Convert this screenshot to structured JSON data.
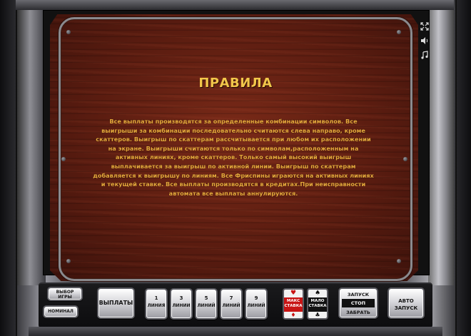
{
  "rules": {
    "title": "ПРАВИЛА",
    "text": "Все выплаты производятся за определенные комбинации символов. Все выигрыши за комбинации последовательно считаются слева направо, кроме скаттеров. Выигрыш по скаттерам рассчитывается при любом их расположении на экране. Выигрыши считаются только по символам,расположенным на активных линиях, кроме скаттеров. Только самый высокий выигрыш выплачивается за выигрыш по активной линии. Выигрыш по скаттерам добавляется к выигрышу по линиям. Все Фриспины играются на активных линиях и текущей ставке. Все выплаты производятся в кредитах.При неисправности автомата все выплаты аннулируются."
  },
  "top_icons": [
    "fullscreen-icon",
    "sound-icon",
    "music-icon"
  ],
  "controls": {
    "select_game": "ВЫБОР ИГРЫ",
    "denomination": "НОМИНАЛ",
    "payouts": "ВЫПЛАТЫ",
    "lines": [
      {
        "num": "1",
        "label": "ЛИНИЯ"
      },
      {
        "num": "3",
        "label": "ЛИНИИ"
      },
      {
        "num": "5",
        "label": "ЛИНИЙ"
      },
      {
        "num": "7",
        "label": "ЛИНИЙ"
      },
      {
        "num": "9",
        "label": "ЛИНИЙ"
      }
    ],
    "max_bet": "МАКС СТАВКА",
    "min_bet": "МАЛО СТАВКА",
    "start": "ЗАПУСК",
    "stop": "СТОП",
    "take": "ЗАБРАТЬ",
    "auto_start": "АВТО ЗАПУСК"
  },
  "colors": {
    "title": "#f2c64a",
    "text": "#e5a93c",
    "wood": "#5a1c10",
    "max_bet_red": "#c81414"
  }
}
